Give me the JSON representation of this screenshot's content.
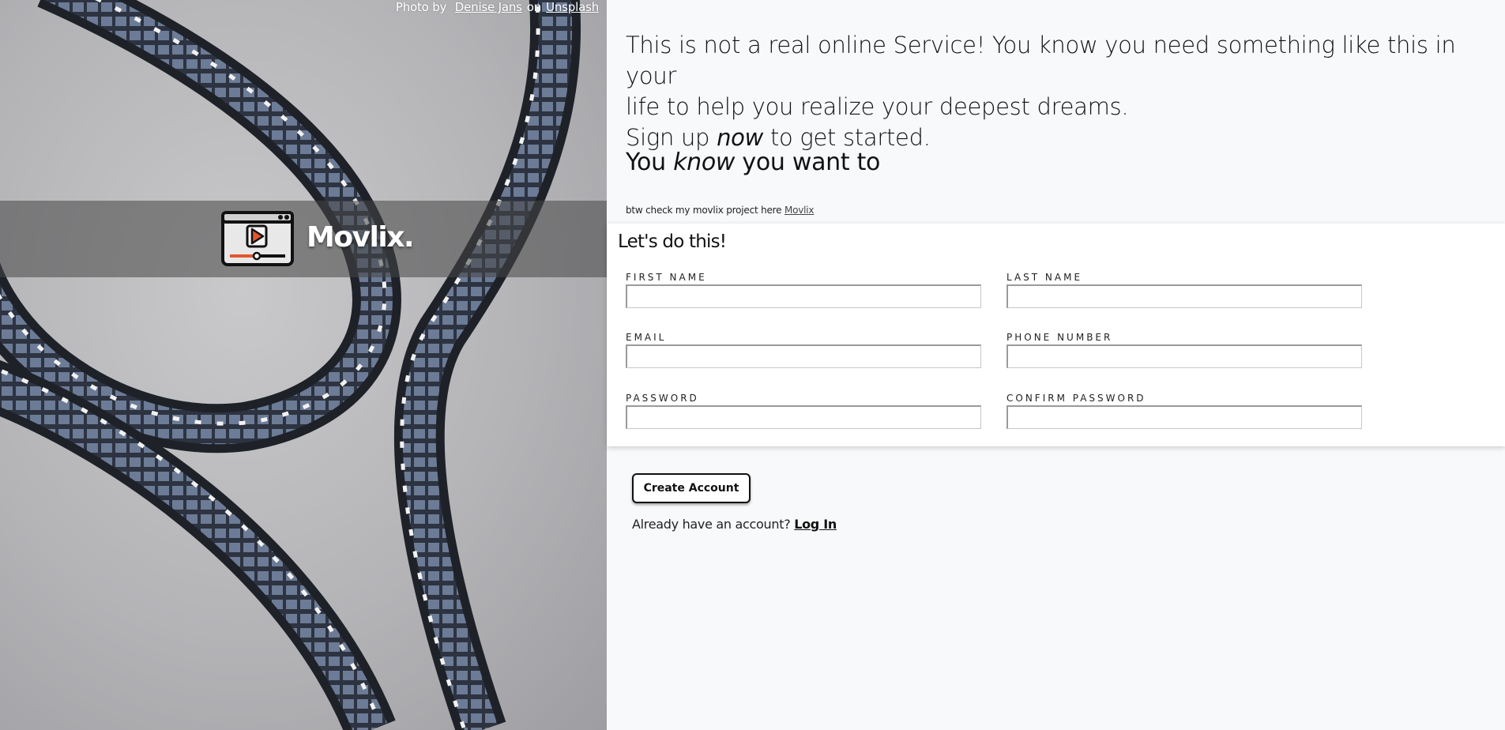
{
  "hero": {
    "credit_prefix": "Photo by",
    "credit_author": "Denise Jans",
    "credit_on": "on",
    "credit_site": "Unsplash",
    "brand_name": "Movlix.",
    "accent_color": "#e4572e"
  },
  "intro": {
    "line1": "This is not a real online Service! You know you need something like this in your",
    "line2": "life to help you realize your deepest dreams.",
    "line3_before": "Sign up",
    "line3_em": "now",
    "line3_after": "to get started.",
    "second_before": "You",
    "second_em": "know",
    "second_after": "you want to",
    "btw_text": "btw check my movlix project here",
    "btw_link": "Movlix"
  },
  "form": {
    "title": "Let's do this!",
    "fields": {
      "first_name": {
        "label": "FIRST NAME",
        "value": ""
      },
      "last_name": {
        "label": "LAST NAME",
        "value": ""
      },
      "email": {
        "label": "EMAIL",
        "value": ""
      },
      "phone": {
        "label": "PHONE NUMBER",
        "value": ""
      },
      "password": {
        "label": "PASSWORD",
        "value": ""
      },
      "confirm_password": {
        "label": "CONFIRM PASSWORD",
        "value": ""
      }
    },
    "create_button": "Create Account",
    "login_prompt": "Already have an account?",
    "login_link": "Log In"
  }
}
